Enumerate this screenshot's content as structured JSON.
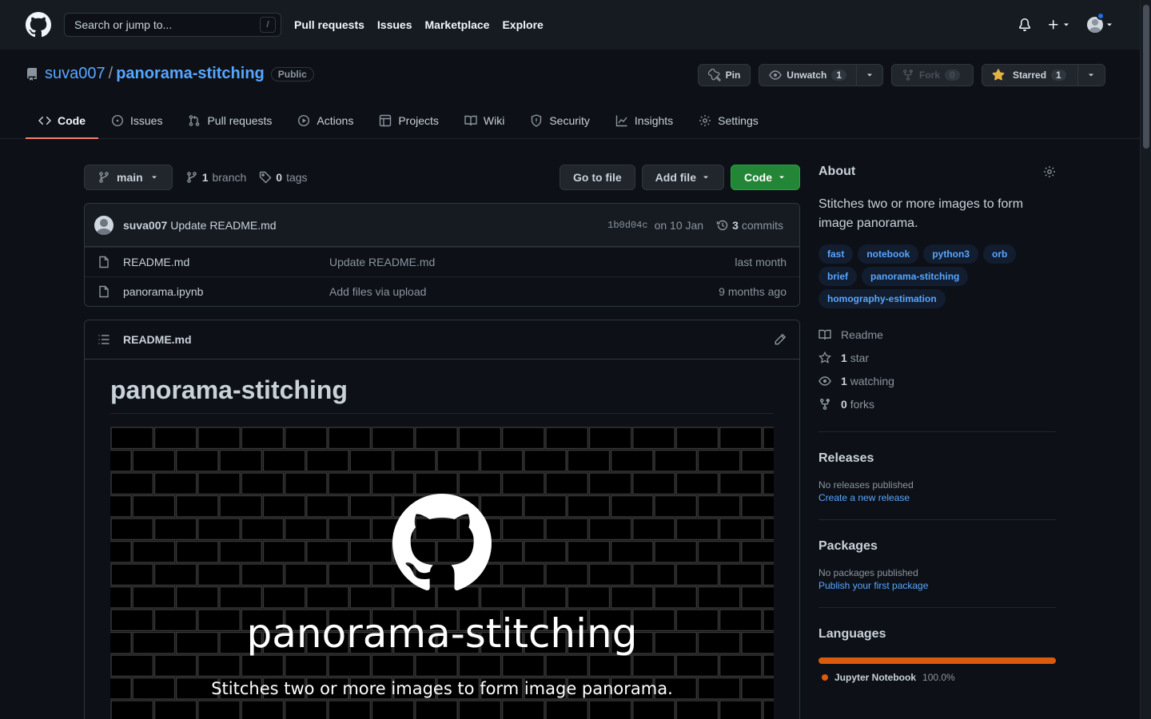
{
  "header": {
    "search_placeholder": "Search or jump to...",
    "search_shortcut": "/",
    "nav": [
      "Pull requests",
      "Issues",
      "Marketplace",
      "Explore"
    ]
  },
  "repo": {
    "owner": "suva007",
    "separator": "/",
    "name": "panorama-stitching",
    "visibility": "Public",
    "pin_label": "Pin",
    "unwatch_label": "Unwatch",
    "watch_count": "1",
    "fork_label": "Fork",
    "fork_count": "0",
    "star_label": "Starred",
    "star_count": "1"
  },
  "tabs": [
    {
      "label": "Code",
      "icon": "code-icon"
    },
    {
      "label": "Issues",
      "icon": "issue-icon"
    },
    {
      "label": "Pull requests",
      "icon": "pull-request-icon"
    },
    {
      "label": "Actions",
      "icon": "play-icon"
    },
    {
      "label": "Projects",
      "icon": "table-icon"
    },
    {
      "label": "Wiki",
      "icon": "book-icon"
    },
    {
      "label": "Security",
      "icon": "shield-icon"
    },
    {
      "label": "Insights",
      "icon": "graph-icon"
    },
    {
      "label": "Settings",
      "icon": "gear-icon"
    }
  ],
  "filebar": {
    "branch": "main",
    "branch_count": "1",
    "branch_label": "branch",
    "tag_count": "0",
    "tag_label": "tags",
    "go_to_file": "Go to file",
    "add_file": "Add file",
    "code": "Code"
  },
  "commit": {
    "author": "suva007",
    "message": "Update README.md",
    "sha": "1b0d04c",
    "date": "on 10 Jan",
    "count": "3",
    "count_label": "commits"
  },
  "files": [
    {
      "name": "README.md",
      "message": "Update README.md",
      "age": "last month"
    },
    {
      "name": "panorama.ipynb",
      "message": "Add files via upload",
      "age": "9 months ago"
    }
  ],
  "readme": {
    "filename": "README.md",
    "heading": "panorama-stitching",
    "banner_title": "panorama-stitching",
    "banner_subtitle": "Stitches two or more images to form image panorama."
  },
  "about": {
    "title": "About",
    "description": "Stitches two or more images to form image panorama.",
    "topics": [
      "fast",
      "notebook",
      "python3",
      "orb",
      "brief",
      "panorama-stitching",
      "homography-estimation"
    ],
    "readme_label": "Readme",
    "stars": "1",
    "stars_label": "star",
    "watching": "1",
    "watching_label": "watching",
    "forks": "0",
    "forks_label": "forks"
  },
  "releases": {
    "title": "Releases",
    "empty": "No releases published",
    "link": "Create a new release"
  },
  "packages": {
    "title": "Packages",
    "empty": "No packages published",
    "link": "Publish your first package"
  },
  "languages": {
    "title": "Languages",
    "items": [
      {
        "name": "Jupyter Notebook",
        "percent": "100.0%",
        "color": "#DA5B0B"
      }
    ]
  },
  "colors": {
    "accent_link": "#58a6ff",
    "tab_underline": "#f78166",
    "green_button": "#238636",
    "star_icon": "#e3b341",
    "notification_dot": "#1f6feb"
  }
}
